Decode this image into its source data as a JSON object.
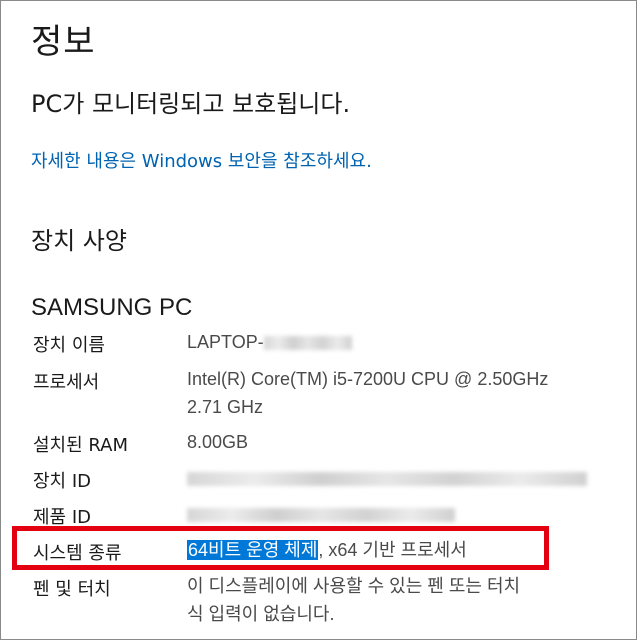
{
  "page": {
    "title": "정보",
    "protection_status": "PC가 모니터링되고 보호됩니다.",
    "security_link": "자세한 내용은 Windows 보안을 참조하세요.",
    "section_title": "장치 사양",
    "device_title": "SAMSUNG PC"
  },
  "specs": {
    "device_name": {
      "label": "장치 이름",
      "value_prefix": "LAPTOP-"
    },
    "processor": {
      "label": "프로세서",
      "value_line1": "Intel(R) Core(TM) i5-7200U CPU @ 2.50GHz",
      "value_line2": "2.71 GHz"
    },
    "ram": {
      "label": "설치된 RAM",
      "value": "8.00GB"
    },
    "device_id": {
      "label": "장치 ID"
    },
    "product_id": {
      "label": "제품 ID"
    },
    "system_type": {
      "label": "시스템 종류",
      "value_selected": "64비트 운영 체제",
      "value_rest": ", x64 기반 프로세서"
    },
    "pen_touch": {
      "label": "펜 및 터치",
      "value_line1": "이 디스플레이에 사용할 수 있는 펜 또는 터치",
      "value_line2": "식 입력이 없습니다."
    }
  },
  "colors": {
    "link": "#0063b1",
    "highlight_border": "#e3000f",
    "selection": "#0078d7"
  }
}
